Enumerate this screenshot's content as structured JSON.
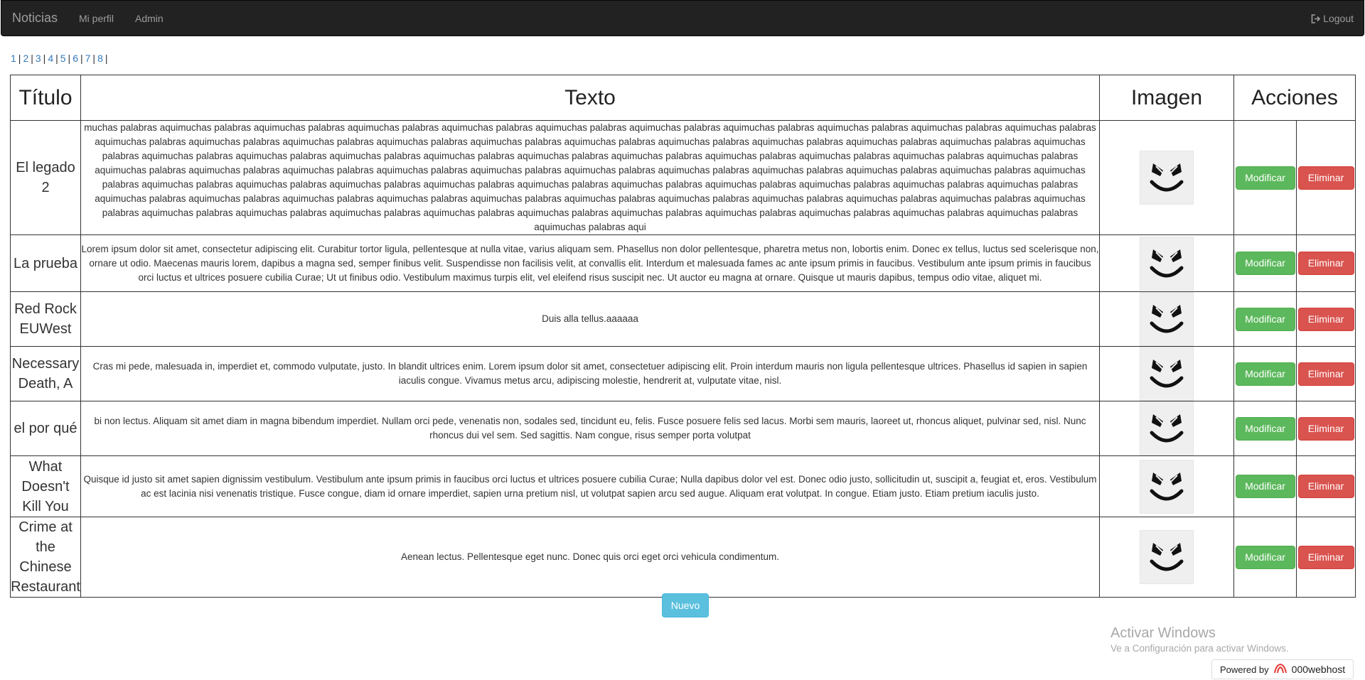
{
  "navbar": {
    "brand": "Noticias",
    "links": [
      "Mi perfil",
      "Admin"
    ],
    "logout": "Logout"
  },
  "pager": [
    "1",
    "2",
    "3",
    "4",
    "5",
    "6",
    "7",
    "8"
  ],
  "pager_separator": "|",
  "table": {
    "headers": [
      "Título",
      "Texto",
      "Imagen",
      "Acciones"
    ],
    "rows": [
      {
        "titulo": "El legado 2",
        "texto": "muchas palabras aquimuchas palabras aquimuchas palabras aquimuchas palabras aquimuchas palabras aquimuchas palabras aquimuchas palabras aquimuchas palabras aquimuchas palabras aquimuchas palabras aquimuchas palabras aquimuchas palabras aquimuchas palabras aquimuchas palabras aquimuchas palabras aquimuchas palabras aquimuchas palabras aquimuchas palabras aquimuchas palabras aquimuchas palabras aquimuchas palabras aquimuchas palabras aquimuchas palabras aquimuchas palabras aquimuchas palabras aquimuchas palabras aquimuchas palabras aquimuchas palabras aquimuchas palabras aquimuchas palabras aquimuchas palabras aquimuchas palabras aquimuchas palabras aquimuchas palabras aquimuchas palabras aquimuchas palabras aquimuchas palabras aquimuchas palabras aquimuchas palabras aquimuchas palabras aquimuchas palabras aquimuchas palabras aquimuchas palabras aquimuchas palabras aquimuchas palabras aquimuchas palabras aquimuchas palabras aquimuchas palabras aquimuchas palabras aquimuchas palabras aquimuchas palabras aquimuchas palabras aquimuchas palabras aquimuchas palabras aquimuchas palabras aquimuchas palabras aquimuchas palabras aquimuchas palabras aquimuchas palabras aquimuchas palabras aquimuchas palabras aquimuchas palabras aquimuchas palabras aquimuchas palabras aquimuchas palabras aquimuchas palabras aquimuchas palabras aquimuchas palabras aquimuchas palabras aquimuchas palabras aquimuchas palabras aquimuchas palabras aquimuchas palabras aquimuchas palabras aquimuchas palabras aqui",
        "image_icon": "marshmello-face-icon"
      },
      {
        "titulo": "La prueba",
        "texto": "Lorem ipsum dolor sit amet, consectetur adipiscing elit. Curabitur tortor ligula, pellentesque at nulla vitae, varius aliquam sem. Phasellus non dolor pellentesque, pharetra metus non, lobortis enim. Donec ex tellus, luctus sed scelerisque non, ornare ut odio. Maecenas mauris lorem, dapibus a magna sed, semper finibus velit. Suspendisse non facilisis velit, at convallis elit. Interdum et malesuada fames ac ante ipsum primis in faucibus. Vestibulum ante ipsum primis in faucibus orci luctus et ultrices posuere cubilia Curae; Ut ut finibus odio. Vestibulum maximus turpis elit, vel eleifend risus suscipit nec. Ut auctor eu magna at ornare. Quisque ut mauris dapibus, tempus odio vitae, aliquet mi.",
        "image_icon": "marshmello-face-icon"
      },
      {
        "titulo": "Red Rock EUWest",
        "texto": "Duis alla tellus.aaaaaa",
        "image_icon": "marshmello-face-icon"
      },
      {
        "titulo": "Necessary Death, A",
        "texto": "Cras mi pede, malesuada in, imperdiet et, commodo vulputate, justo. In blandit ultrices enim. Lorem ipsum dolor sit amet, consectetuer adipiscing elit. Proin interdum mauris non ligula pellentesque ultrices. Phasellus id sapien in sapien iaculis congue. Vivamus metus arcu, adipiscing molestie, hendrerit at, vulputate vitae, nisl.",
        "image_icon": "marshmello-face-icon"
      },
      {
        "titulo": "el por qué",
        "texto": "bi non lectus. Aliquam sit amet diam in magna bibendum imperdiet. Nullam orci pede, venenatis non, sodales sed, tincidunt eu, felis. Fusce posuere felis sed lacus. Morbi sem mauris, laoreet ut, rhoncus aliquet, pulvinar sed, nisl. Nunc rhoncus dui vel sem. Sed sagittis. Nam congue, risus semper porta volutpat",
        "image_icon": "marshmello-face-icon"
      },
      {
        "titulo": "What Doesn't Kill You",
        "texto": "Quisque id justo sit amet sapien dignissim vestibulum. Vestibulum ante ipsum primis in faucibus orci luctus et ultrices posuere cubilia Curae; Nulla dapibus dolor vel est. Donec odio justo, sollicitudin ut, suscipit a, feugiat et, eros. Vestibulum ac est lacinia nisi venenatis tristique. Fusce congue, diam id ornare imperdiet, sapien urna pretium nisl, ut volutpat sapien arcu sed augue. Aliquam erat volutpat. In congue. Etiam justo. Etiam pretium iaculis justo.",
        "image_icon": "marshmello-face-icon"
      },
      {
        "titulo": "Crime at the Chinese Restaurant",
        "texto": "Aenean lectus. Pellentesque eget nunc. Donec quis orci eget orci vehicula condimentum.",
        "image_icon": "marshmello-face-icon"
      }
    ],
    "btn_modificar": "Modificar",
    "btn_eliminar": "Eliminar"
  },
  "btn_nuevo": "Nuevo",
  "watermark": {
    "title": "Activar Windows",
    "subtitle": "Ve a Configuración para activar Windows."
  },
  "powered": {
    "label": "Powered by",
    "host": "000webhost"
  },
  "colors": {
    "navbar_bg": "#222222",
    "link": "#337ab7",
    "success": "#5cb85c",
    "danger": "#d9534f",
    "info": "#5bc0de"
  }
}
